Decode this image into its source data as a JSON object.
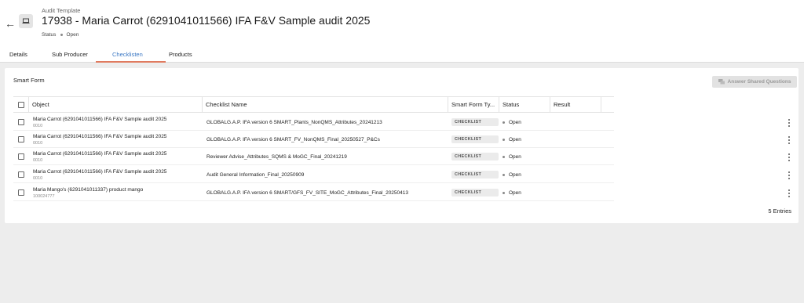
{
  "header": {
    "subtitle": "Audit Template",
    "title": "17938 - Maria Carrot (6291041011566) IFA F&V Sample audit 2025",
    "status_label": "Status",
    "status_value": "Open"
  },
  "tabs": [
    {
      "label": "Details"
    },
    {
      "label": "Sub Producer"
    },
    {
      "label": "Checklisten"
    },
    {
      "label": "Products"
    }
  ],
  "card": {
    "title": "Smart Form",
    "shared_button": "Answer Shared Questions",
    "entries": "5 Entries"
  },
  "table": {
    "columns": [
      "Object",
      "Checklist Name",
      "Smart Form Ty...",
      "Status",
      "Result"
    ],
    "rows": [
      {
        "object": "Maria Carrot (6291041011566) IFA F&V Sample audit 2025",
        "object_sub": "0010",
        "checklist": "GLOBALG.A.P. IFA version 6 SMART_Plants_NonQMS_Attributes_20241213",
        "type": "CHECKLIST",
        "status": "Open",
        "result": ""
      },
      {
        "object": "Maria Carrot (6291041011566) IFA F&V Sample audit 2025",
        "object_sub": "0010",
        "checklist": "GLOBALG.A.P. IFA version 6 SMART_FV_NonQMS_Final_20250527_P&Cs",
        "type": "CHECKLIST",
        "status": "Open",
        "result": ""
      },
      {
        "object": "Maria Carrot (6291041011566) IFA F&V Sample audit 2025",
        "object_sub": "0010",
        "checklist": "Reviewer Advise_Attributes_SQMS & MoGC_Final_20241219",
        "type": "CHECKLIST",
        "status": "Open",
        "result": ""
      },
      {
        "object": "Maria Carrot (6291041011566) IFA F&V Sample audit 2025",
        "object_sub": "0010",
        "checklist": "Audit General Information_Final_20250909",
        "type": "CHECKLIST",
        "status": "Open",
        "result": ""
      },
      {
        "object": "Maria Mango's (6291041011337) product mango",
        "object_sub": "100024777",
        "checklist": "GLOBALG.A.P. IFA version 6 SMART/GFS_FV_SITE_MoGC_Attributes_Final_20250413",
        "type": "CHECKLIST",
        "status": "Open",
        "result": ""
      }
    ]
  }
}
